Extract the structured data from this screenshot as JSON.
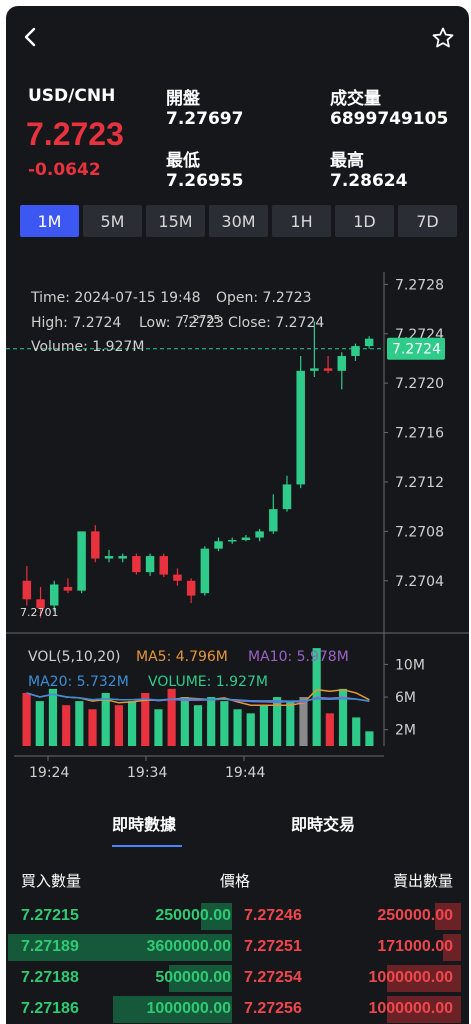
{
  "header": {
    "pair": "USD/CNH",
    "price": "7.2723",
    "change": "-0.0642",
    "open_label": "開盤",
    "open_value": "7.27697",
    "volume_label": "成交量",
    "volume_value": "6899749105",
    "low_label": "最低",
    "low_value": "7.26955",
    "high_label": "最高",
    "high_value": "7.28624"
  },
  "intervals": [
    "1M",
    "5M",
    "15M",
    "30M",
    "1H",
    "1D",
    "7D"
  ],
  "active_interval": "1M",
  "tooltip": {
    "time": "Time: 2024-07-15 19:48",
    "open": "Open: 7.2723",
    "high": "High: 7.2724",
    "low": "Low: 7.2723",
    "close": "Close: 7.2724",
    "volume": "Volume: 1.927M"
  },
  "chart_data": {
    "type": "candlestick",
    "y_ticks": [
      "7.2728",
      "7.2724",
      "7.2720",
      "7.2716",
      "7.2712",
      "7.2708",
      "7.2704"
    ],
    "ylim": [
      7.27005,
      7.2729
    ],
    "current_price_label": "7.2724",
    "min_label": "7.2701",
    "max_label": "7.2725",
    "x_ticks": [
      "19:24",
      "19:34",
      "19:44"
    ],
    "candles": [
      {
        "o": 7.2704,
        "h": 7.27052,
        "l": 7.2702,
        "c": 7.27025
      },
      {
        "o": 7.27025,
        "h": 7.27035,
        "l": 7.2701,
        "c": 7.27018
      },
      {
        "o": 7.2702,
        "h": 7.2704,
        "l": 7.27015,
        "c": 7.27037
      },
      {
        "o": 7.27035,
        "h": 7.27042,
        "l": 7.2703,
        "c": 7.27032
      },
      {
        "o": 7.27032,
        "h": 7.2707,
        "l": 7.2703,
        "c": 7.2708
      },
      {
        "o": 7.2708,
        "h": 7.27085,
        "l": 7.27055,
        "c": 7.27058
      },
      {
        "o": 7.27058,
        "h": 7.27065,
        "l": 7.27055,
        "c": 7.2706
      },
      {
        "o": 7.27058,
        "h": 7.27062,
        "l": 7.27055,
        "c": 7.2706
      },
      {
        "o": 7.2706,
        "h": 7.27062,
        "l": 7.27045,
        "c": 7.27047
      },
      {
        "o": 7.27047,
        "h": 7.27062,
        "l": 7.27044,
        "c": 7.2706
      },
      {
        "o": 7.2706,
        "h": 7.27062,
        "l": 7.27043,
        "c": 7.27045
      },
      {
        "o": 7.27045,
        "h": 7.2705,
        "l": 7.27036,
        "c": 7.2704
      },
      {
        "o": 7.2704,
        "h": 7.27042,
        "l": 7.27022,
        "c": 7.27028
      },
      {
        "o": 7.2703,
        "h": 7.27068,
        "l": 7.27028,
        "c": 7.27066
      },
      {
        "o": 7.27066,
        "h": 7.27075,
        "l": 7.27064,
        "c": 7.27072
      },
      {
        "o": 7.27072,
        "h": 7.27075,
        "l": 7.2707,
        "c": 7.27073
      },
      {
        "o": 7.27073,
        "h": 7.27077,
        "l": 7.27072,
        "c": 7.27075
      },
      {
        "o": 7.27075,
        "h": 7.27082,
        "l": 7.27072,
        "c": 7.2708
      },
      {
        "o": 7.2708,
        "h": 7.2711,
        "l": 7.27078,
        "c": 7.27098
      },
      {
        "o": 7.27098,
        "h": 7.27125,
        "l": 7.27096,
        "c": 7.27118
      },
      {
        "o": 7.27118,
        "h": 7.27222,
        "l": 7.27115,
        "c": 7.2721
      },
      {
        "o": 7.2721,
        "h": 7.2725,
        "l": 7.27205,
        "c": 7.27212
      },
      {
        "o": 7.27212,
        "h": 7.27222,
        "l": 7.27208,
        "c": 7.2721
      },
      {
        "o": 7.2721,
        "h": 7.27225,
        "l": 7.27195,
        "c": 7.27222
      },
      {
        "o": 7.27222,
        "h": 7.27232,
        "l": 7.27218,
        "c": 7.2723
      },
      {
        "o": 7.2723,
        "h": 7.27238,
        "l": 7.27228,
        "c": 7.27236
      }
    ],
    "volume": {
      "legend_title": "VOL(5,10,20)",
      "ma5": "MA5: 4.796M",
      "ma10": "MA10: 5.978M",
      "ma20": "MA20: 5.732M",
      "vol": "VOLUME: 1.927M",
      "y_ticks": [
        "10M",
        "6M",
        "2M"
      ],
      "ylim": [
        0,
        12.5
      ],
      "values": [
        6.5,
        5.5,
        7.0,
        5.0,
        5.5,
        4.5,
        6.5,
        5.0,
        5.5,
        6.5,
        4.5,
        7.0,
        6.0,
        5.0,
        6.0,
        5.5,
        4.5,
        4.0,
        5.0,
        6.0,
        5.5,
        6.0,
        12.0,
        4.0,
        7.0,
        3.5,
        1.8
      ],
      "ups": [
        false,
        true,
        true,
        false,
        true,
        false,
        true,
        false,
        true,
        false,
        true,
        false,
        true,
        true,
        true,
        true,
        true,
        true,
        true,
        true,
        true,
        true,
        true,
        false,
        true,
        true,
        true
      ]
    }
  },
  "section_tabs": {
    "realtime": "即時數據",
    "trade": "即時交易"
  },
  "book": {
    "bid_header": "買入數量",
    "price_header": "價格",
    "ask_header": "賣出數量",
    "rows": [
      {
        "bid_price": "7.27215",
        "bid_qty": "250000.00",
        "ask_price": "7.27246",
        "ask_qty": "250000.00",
        "bid_fill": 0.14,
        "ask_fill": 0.29
      },
      {
        "bid_price": "7.27189",
        "bid_qty": "3600000.00",
        "ask_price": "7.27251",
        "ask_qty": "171000.00",
        "bid_fill": 1.0,
        "ask_fill": 0.2
      },
      {
        "bid_price": "7.27188",
        "bid_qty": "500000.00",
        "ask_price": "7.27254",
        "ask_qty": "1000000.00",
        "bid_fill": 0.28,
        "ask_fill": 0.82
      },
      {
        "bid_price": "7.27186",
        "bid_qty": "1000000.00",
        "ask_price": "7.27256",
        "ask_qty": "1000000.00",
        "bid_fill": 0.53,
        "ask_fill": 0.82
      }
    ]
  },
  "colors": {
    "up": "#2ecb8a",
    "down": "#e8323e",
    "accent": "#3d58f2",
    "ma5": "#e3973b",
    "ma10": "#9a62c4",
    "ma20": "#3b8fd6",
    "vol_flat": "#8a8a8a"
  }
}
